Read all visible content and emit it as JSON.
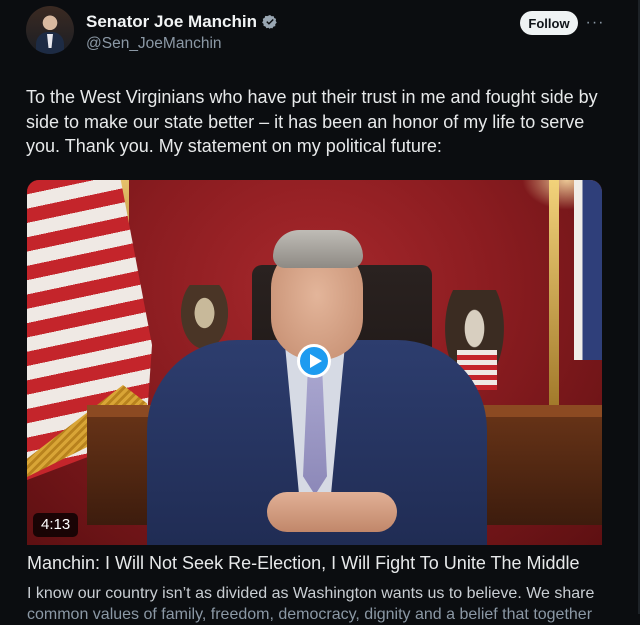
{
  "author": {
    "display_name": "Senator Joe Manchin",
    "handle": "@Sen_JoeManchin",
    "verified": true,
    "avatar_icon": "person-avatar"
  },
  "actions": {
    "follow_label": "Follow",
    "more_label": "···"
  },
  "tweet": {
    "text": "To the West Virginians who have put their trust in me and fought side by side to make our state better – it has been an honor of my life to serve you. Thank you. My statement on my political future:"
  },
  "video": {
    "duration": "4:13",
    "play_icon": "play-icon"
  },
  "link_card": {
    "title": "Manchin: I Will Not Seek Re-Election, I Will Fight To Unite The Middle",
    "description_line1": "I know our country isn’t as divided as Washington wants us to believe. We share",
    "description_line2": "common values of family, freedom, democracy, dignity and a belief that together"
  },
  "colors": {
    "background": "#0b0d10",
    "accent": "#1d9bf0",
    "secondary_text": "#8b98a5"
  }
}
